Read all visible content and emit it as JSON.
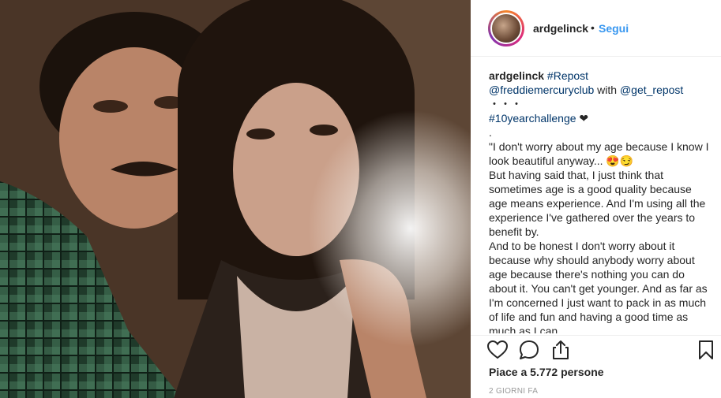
{
  "post": {
    "username": "ardgelinck",
    "follow_label": "Segui",
    "separator": "•"
  },
  "caption": {
    "author": "ardgelinck",
    "tag_repost": "#Repost",
    "mention_source": "@freddiemercuryclub",
    "with_word": "with",
    "mention_tool": "@get_repost",
    "dots_line": "・・・",
    "tag_challenge": "#10yearchallenge",
    "heart": "❤",
    "period_line": ".",
    "quote_line_1": "\"I don't worry about my age because I know I look beautiful anyway... 😍😏",
    "quote_line_2": "But having said that, I just think that sometimes age is a good quality because age means experience. And I'm using all the experience I've gathered over the years to benefit by.",
    "quote_line_3": "And to be honest I don't worry about it because why should anybody worry about age because there's nothing you can do about it. You can't get younger. And as far as I'm concerned I just want to pack in as much of life and fun and having a good time as much as I can."
  },
  "footer": {
    "likes_text": "Piace a 5.772 persone",
    "timestamp": "2 GIORNI FA"
  },
  "icons": {
    "like": "heart-outline-icon",
    "comment": "speech-bubble-icon",
    "share": "share-icon",
    "save": "bookmark-icon"
  },
  "colors": {
    "link": "#003569",
    "follow": "#3897f0",
    "text": "#262626",
    "muted": "#999999"
  }
}
